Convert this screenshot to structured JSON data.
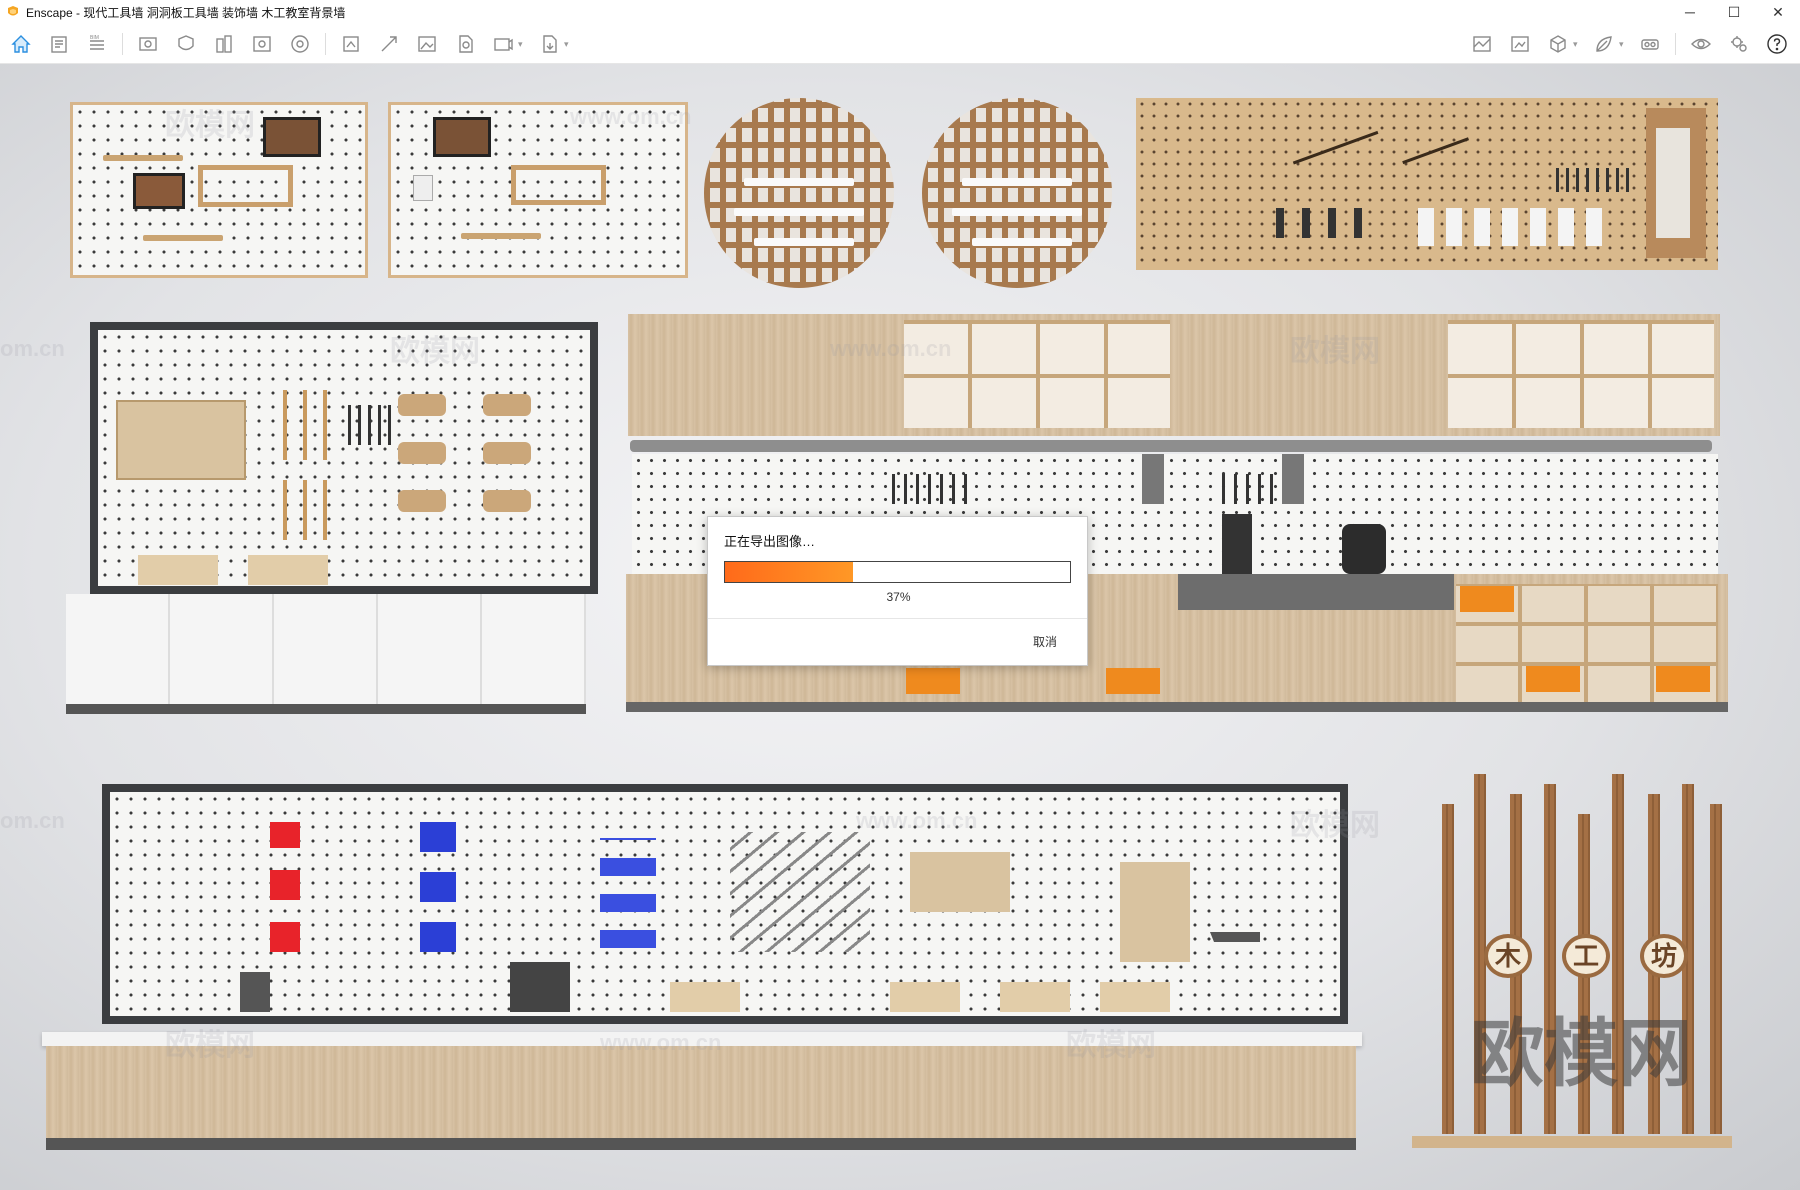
{
  "window": {
    "title": "Enscape - 现代工具墙 洞洞板工具墙 装饰墙 木工教室背景墙",
    "controls": {
      "minimize": "─",
      "maximize": "☐",
      "close": "✕"
    }
  },
  "toolbar": {
    "left_icons": [
      "home-icon",
      "project-icon",
      "bim-icon",
      "view-icon",
      "clip-icon",
      "buildings-icon",
      "asset-icon",
      "material-icon",
      "frame-icon",
      "batch-icon",
      "image-icon",
      "panorama-icon",
      "video-icon",
      "export-icon"
    ],
    "right_icons": [
      "map-icon",
      "screenshot-icon",
      "cube-icon",
      "leaf-icon",
      "vr-icon",
      "visibility-icon",
      "settings-icon",
      "help-icon"
    ]
  },
  "dialog": {
    "title": "正在导出图像…",
    "progress_value": 0.37,
    "progress_text": "37%",
    "cancel_label": "取消"
  },
  "scene": {
    "sign_chars": [
      "木",
      "工",
      "坊"
    ],
    "watermarks": [
      "欧模网",
      "www.om.cn",
      "om.cn"
    ],
    "big_watermark": "欧模网"
  },
  "colors": {
    "accent": "#2b8fe0",
    "progress_start": "#ff6a1a",
    "progress_end": "#ff9826",
    "wood": "#d8c2a4",
    "dark_frame": "#3b3d40"
  }
}
